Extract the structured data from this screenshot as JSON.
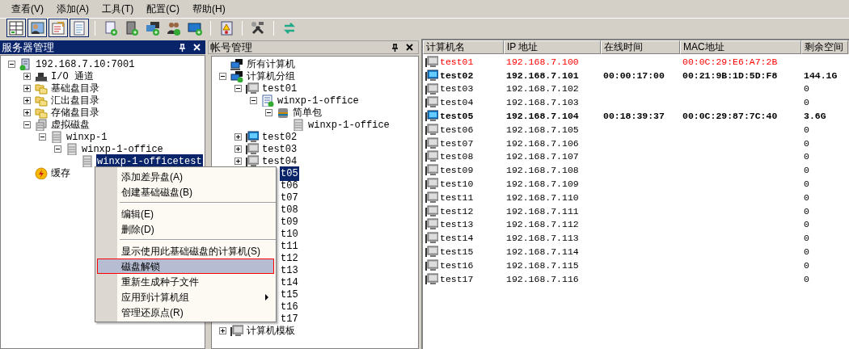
{
  "menu_bar": [
    "查看(V)",
    "添加(A)",
    "工具(T)",
    "配置(C)",
    "帮助(H)"
  ],
  "server_panel": {
    "title": "服务器管理",
    "tree": [
      {
        "label": "192.168.7.10:7001",
        "kind": "server",
        "expanded": true,
        "selected": false,
        "children": [
          {
            "label": "I/O 通道",
            "kind": "io",
            "expanded": false,
            "selected": false
          },
          {
            "label": "基础盘目录",
            "kind": "folder",
            "expanded": false,
            "selected": false
          },
          {
            "label": "汇出盘目录",
            "kind": "folder",
            "expanded": false,
            "selected": false
          },
          {
            "label": "存储盘目录",
            "kind": "folder",
            "expanded": false,
            "selected": false
          },
          {
            "label": "虚拟磁盘",
            "kind": "disks",
            "expanded": true,
            "selected": false,
            "children": [
              {
                "label": "winxp-1",
                "kind": "disk",
                "expanded": true,
                "selected": false,
                "children": [
                  {
                    "label": "winxp-1-office",
                    "kind": "disk",
                    "expanded": true,
                    "selected": false,
                    "children": [
                      {
                        "label": "winxp-1-officetest",
                        "kind": "disk",
                        "selected": true
                      }
                    ]
                  }
                ]
              }
            ]
          },
          {
            "label": "缓存",
            "kind": "cache",
            "selected": false
          }
        ]
      }
    ]
  },
  "account_panel": {
    "title": "帐号管理",
    "tree": [
      {
        "label": "所有计算机",
        "kind": "network",
        "selected": false
      },
      {
        "label": "计算机分组",
        "kind": "group",
        "expanded": true,
        "selected": false,
        "children": [
          {
            "label": "test01",
            "kind": "computer",
            "expanded": true,
            "selected": false,
            "children": [
              {
                "label": "winxp-1-office",
                "kind": "config",
                "expanded": true,
                "selected": false,
                "children": [
                  {
                    "label": "简单包",
                    "kind": "package",
                    "expanded": true,
                    "selected": false,
                    "children": [
                      {
                        "label": "winxp-1-office",
                        "kind": "disk",
                        "selected": false
                      }
                    ]
                  }
                ]
              }
            ]
          },
          {
            "label": "test02",
            "kind": "computer-online",
            "expanded": false,
            "selected": false
          },
          {
            "label": "test03",
            "kind": "computer",
            "expanded": false,
            "selected": false
          },
          {
            "label": "test04",
            "kind": "computer",
            "expanded": false,
            "selected": false
          },
          {
            "label": "t05",
            "kind": "covered",
            "selected": true
          },
          {
            "label": "t06",
            "kind": "covered",
            "selected": false
          },
          {
            "label": "t07",
            "kind": "covered",
            "selected": false
          },
          {
            "label": "t08",
            "kind": "covered",
            "selected": false
          },
          {
            "label": "t09",
            "kind": "covered",
            "selected": false
          },
          {
            "label": "t10",
            "kind": "covered",
            "selected": false
          },
          {
            "label": "t11",
            "kind": "covered",
            "selected": false
          },
          {
            "label": "t12",
            "kind": "covered",
            "selected": false
          },
          {
            "label": "t13",
            "kind": "covered",
            "selected": false
          },
          {
            "label": "t14",
            "kind": "covered",
            "selected": false
          },
          {
            "label": "t15",
            "kind": "covered",
            "selected": false
          },
          {
            "label": "t16",
            "kind": "covered",
            "selected": false
          },
          {
            "label": "t17",
            "kind": "covered",
            "selected": false
          }
        ]
      },
      {
        "label": "计算机模板",
        "kind": "computer",
        "expanded": false,
        "selected": false
      }
    ]
  },
  "computer_table": {
    "columns": [
      "计算机名",
      "IP 地址",
      "在线时间",
      "MAC地址",
      "剩余空间"
    ],
    "rows": [
      {
        "kind": "alert",
        "name": "test01",
        "ip": "192.168.7.100",
        "mac": "00:0C:29:E6:A7:2B"
      },
      {
        "kind": "online",
        "name": "test02",
        "ip": "192.168.7.101",
        "online_time": "00:00:17:00",
        "mac": "00:21:9B:1D:5D:F8",
        "free_space": "144.1G"
      },
      {
        "kind": "offline",
        "name": "test03",
        "ip": "192.168.7.102",
        "free_space": "0"
      },
      {
        "kind": "offline",
        "name": "test04",
        "ip": "192.168.7.103",
        "free_space": "0"
      },
      {
        "kind": "online",
        "name": "test05",
        "ip": "192.168.7.104",
        "online_time": "00:18:39:37",
        "mac": "00:0C:29:87:7C:40",
        "free_space": "3.6G"
      },
      {
        "kind": "offline",
        "name": "test06",
        "ip": "192.168.7.105",
        "free_space": "0"
      },
      {
        "kind": "offline",
        "name": "test07",
        "ip": "192.168.7.106",
        "free_space": "0"
      },
      {
        "kind": "offline",
        "name": "test08",
        "ip": "192.168.7.107",
        "free_space": "0"
      },
      {
        "kind": "offline",
        "name": "test09",
        "ip": "192.168.7.108",
        "free_space": "0"
      },
      {
        "kind": "offline",
        "name": "test10",
        "ip": "192.168.7.109",
        "free_space": "0"
      },
      {
        "kind": "offline",
        "name": "test11",
        "ip": "192.168.7.110",
        "free_space": "0"
      },
      {
        "kind": "offline",
        "name": "test12",
        "ip": "192.168.7.111",
        "free_space": "0"
      },
      {
        "kind": "offline",
        "name": "test13",
        "ip": "192.168.7.112",
        "free_space": "0"
      },
      {
        "kind": "offline",
        "name": "test14",
        "ip": "192.168.7.113",
        "free_space": "0"
      },
      {
        "kind": "offline",
        "name": "test15",
        "ip": "192.168.7.114",
        "free_space": "0"
      },
      {
        "kind": "offline",
        "name": "test16",
        "ip": "192.168.7.115",
        "free_space": "0"
      },
      {
        "kind": "offline",
        "name": "test17",
        "ip": "192.168.7.116",
        "free_space": "0"
      }
    ]
  },
  "context_menu": {
    "items": [
      {
        "kind": "item",
        "label": "添加差异盘(A)",
        "selected": false,
        "has_submenu": false
      },
      {
        "kind": "item",
        "label": "创建基础磁盘(B)",
        "selected": false,
        "has_submenu": false
      },
      {
        "kind": "separator"
      },
      {
        "kind": "item",
        "label": "编辑(E)",
        "selected": false,
        "has_submenu": false
      },
      {
        "kind": "item",
        "label": "删除(D)",
        "selected": false,
        "has_submenu": false
      },
      {
        "kind": "separator"
      },
      {
        "kind": "item",
        "label": "显示使用此基础磁盘的计算机(S)",
        "selected": false,
        "has_submenu": false
      },
      {
        "kind": "item",
        "label": "磁盘解锁",
        "selected": true,
        "has_submenu": false
      },
      {
        "kind": "item",
        "label": "重新生成种子文件",
        "selected": false,
        "has_submenu": false
      },
      {
        "kind": "item",
        "label": "应用到计算机组",
        "selected": false,
        "has_submenu": true
      },
      {
        "kind": "item",
        "label": "管理还原点(R)",
        "selected": false,
        "has_submenu": false
      }
    ]
  }
}
